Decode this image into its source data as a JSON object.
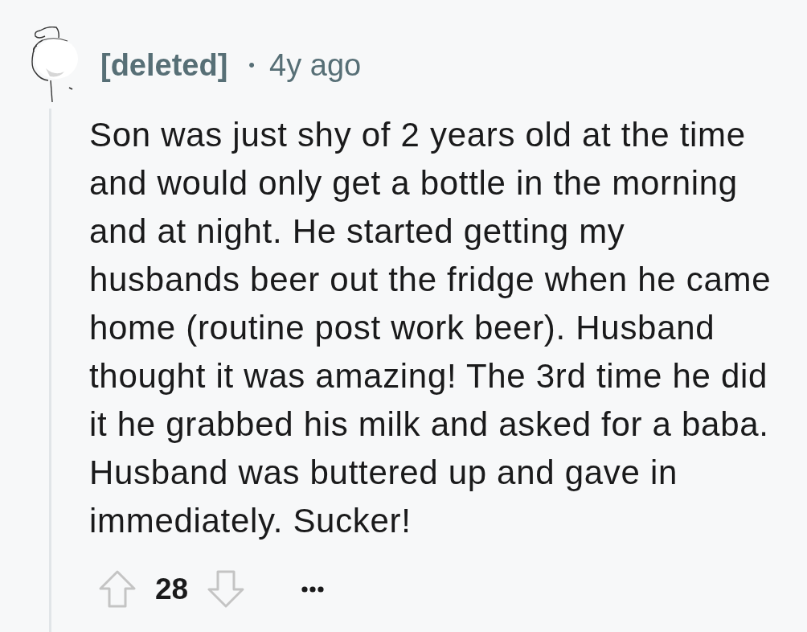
{
  "comment": {
    "author": "[deleted]",
    "separator": "•",
    "age": "4y ago",
    "body": "Son was just shy of 2 years old at the time and would only get a bottle in the morning and at night. He started getting my husbands beer out the fridge when he came home (routine post work beer). Husband thought it was amazing! The 3rd time he did it he grabbed his milk and asked for a baba. Husband was buttered up and gave in immediately. Sucker!",
    "score": "28",
    "upvoted": false,
    "downvoted": false
  }
}
